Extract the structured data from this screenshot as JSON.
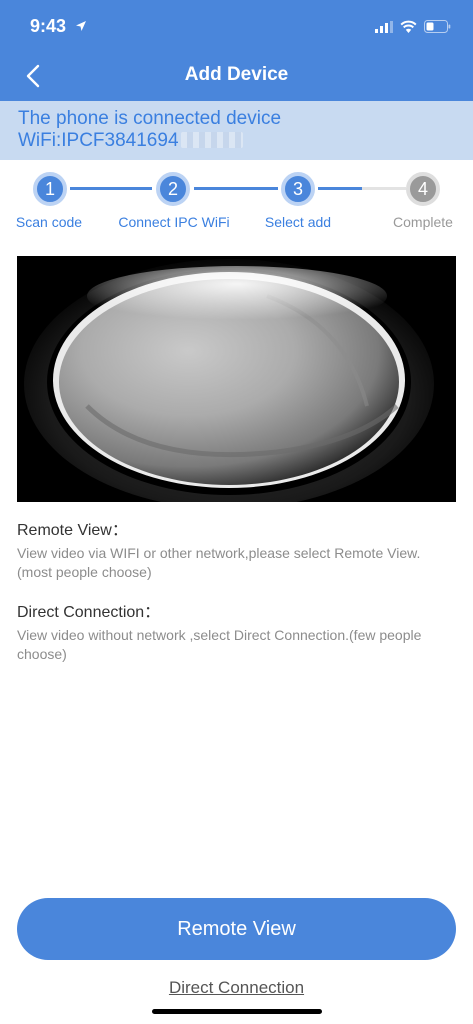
{
  "status_bar": {
    "time": "9:43"
  },
  "header": {
    "title": "Add Device",
    "bg_color": "#4a86db"
  },
  "banner": {
    "line1": "The phone is connected device",
    "line2": "WiFi:IPCF3841694"
  },
  "steps": [
    {
      "number": "1",
      "label": "Scan code",
      "state": "done"
    },
    {
      "number": "2",
      "label": "Connect IPC WiFi",
      "state": "done"
    },
    {
      "number": "3",
      "label": "Select add",
      "state": "current"
    },
    {
      "number": "4",
      "label": "Complete",
      "state": "pending"
    }
  ],
  "remote_view": {
    "title": "Remote View：",
    "desc": "View video via WIFI or other network,please select Remote View.(most people choose)"
  },
  "direct_connection": {
    "title": "Direct Connection：",
    "desc": "View video without network ,select Direct Connection.(few people choose)"
  },
  "buttons": {
    "primary": "Remote View",
    "secondary": "Direct Connection"
  }
}
